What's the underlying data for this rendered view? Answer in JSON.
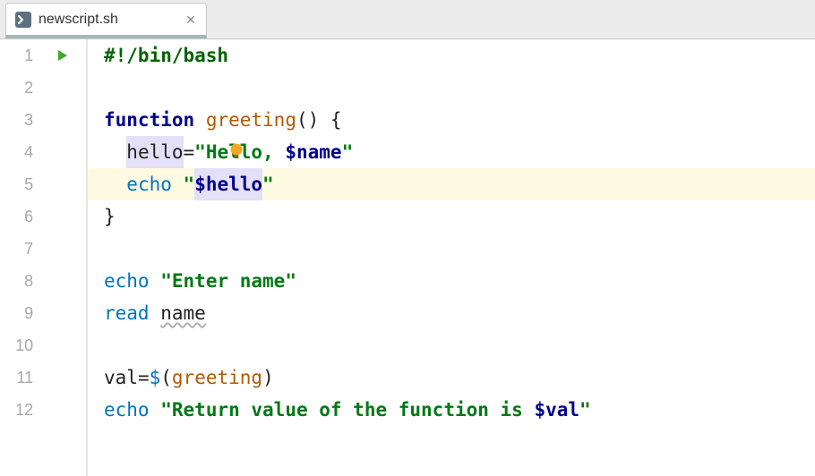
{
  "tab": {
    "filename": "newscript.sh",
    "file_icon": "terminal-file-icon",
    "close_label": "✕"
  },
  "gutter": {
    "lines": [
      "1",
      "2",
      "3",
      "4",
      "5",
      "6",
      "7",
      "8",
      "9",
      "10",
      "11",
      "12"
    ],
    "run_marker_line": 1
  },
  "highlight_line": 5,
  "code": {
    "l1": {
      "shebang": "#!/bin/bash"
    },
    "l3": {
      "kw": "function",
      "fn": "greeting",
      "rest": "() {"
    },
    "l4": {
      "indent": "  ",
      "varname": "hello",
      "assign": "=",
      "q": "\"",
      "str1": "Hello, ",
      "var": "$name",
      "bulb": "lightbulb-icon"
    },
    "l5": {
      "indent": "  ",
      "builtin": "echo",
      "sp": " ",
      "q": "\"",
      "var": "$hello"
    },
    "l6": {
      "brace": "}"
    },
    "l8": {
      "builtin": "echo",
      "sp": " ",
      "q": "\"",
      "str": "Enter name"
    },
    "l9": {
      "builtin": "read",
      "sp": " ",
      "name": "name"
    },
    "l11": {
      "lhs": "val",
      "assign": "=",
      "dollar": "$",
      "lp": "(",
      "fn": "greeting",
      "rp": ")"
    },
    "l12": {
      "builtin": "echo",
      "sp": " ",
      "q": "\"",
      "str": "Return value of the function is ",
      "var": "$val"
    }
  }
}
